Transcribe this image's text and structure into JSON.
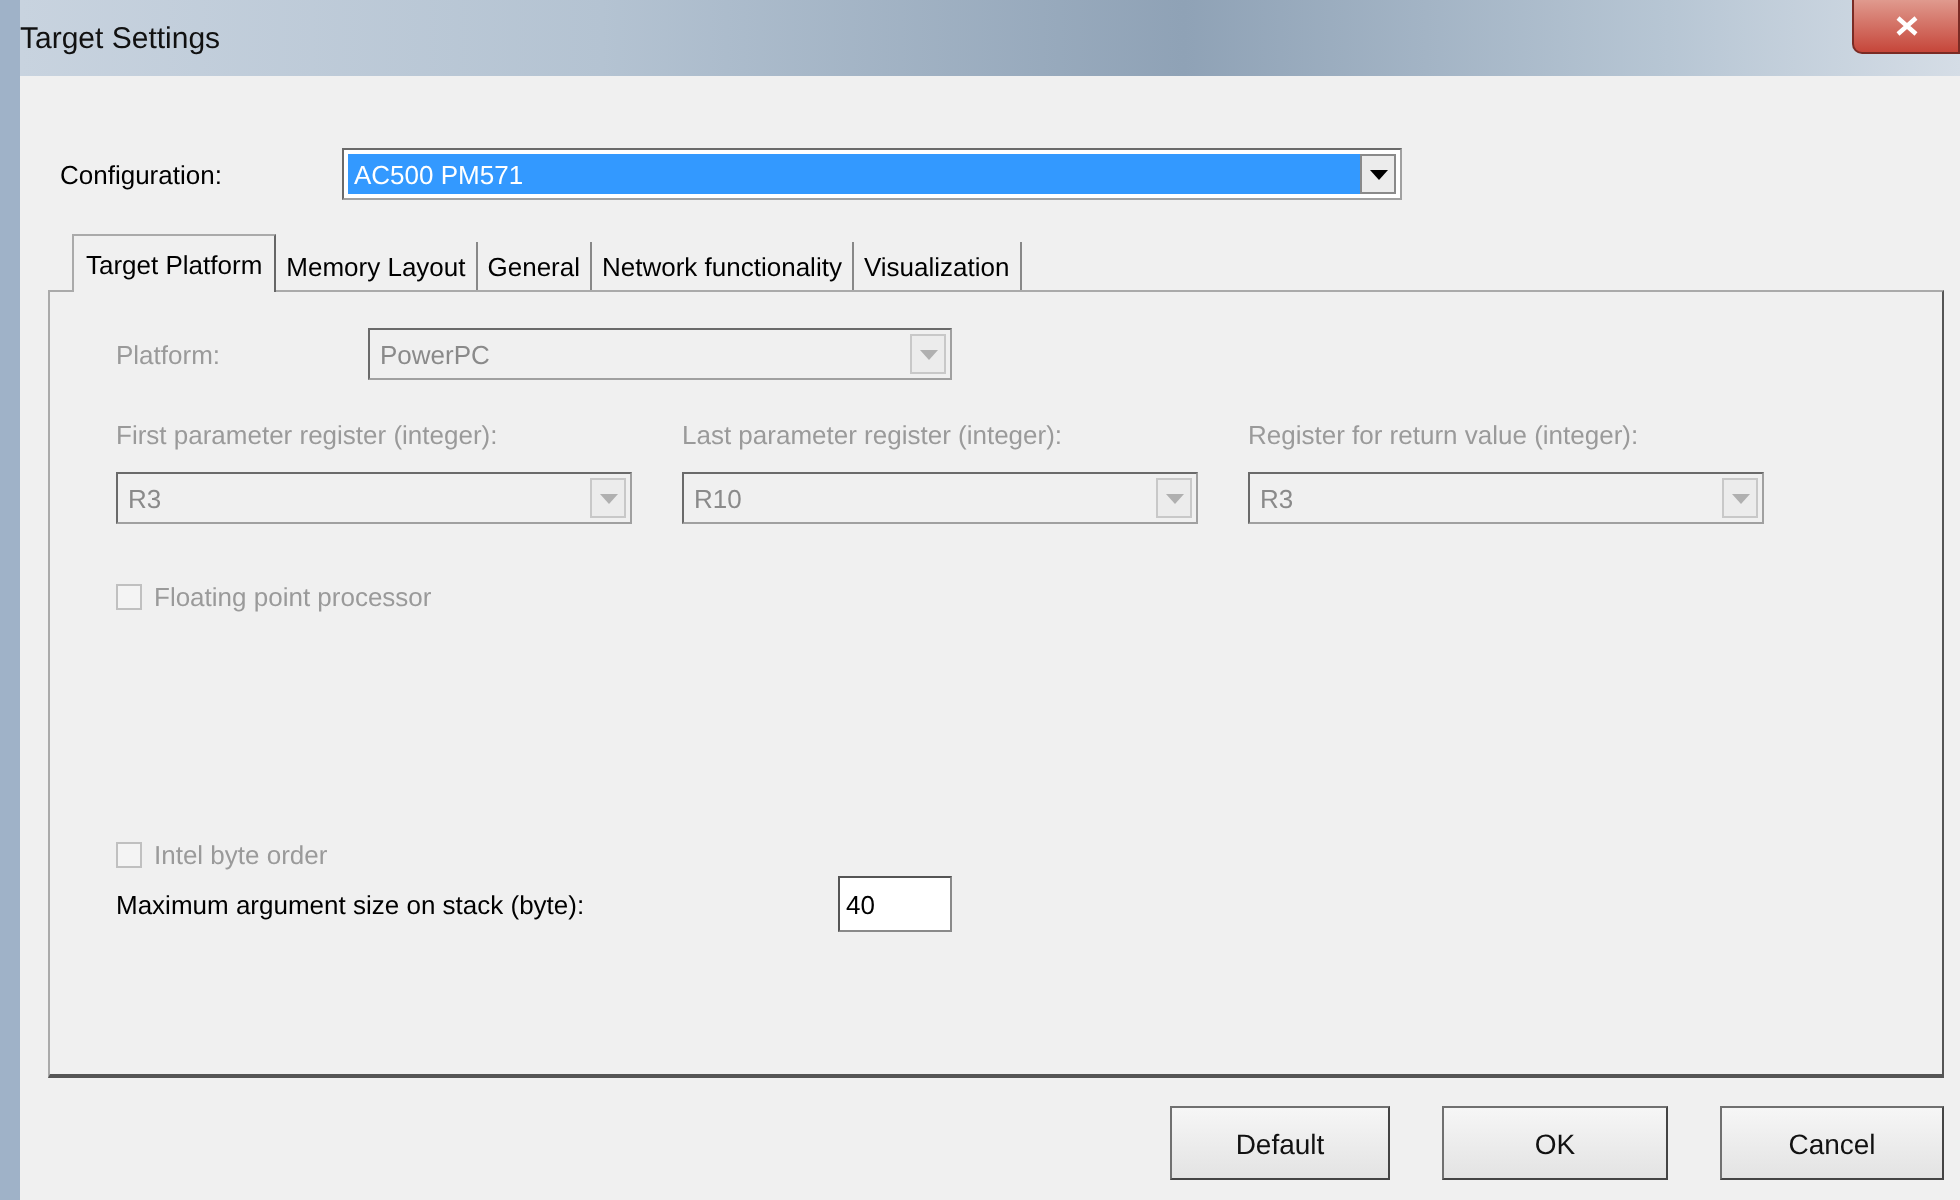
{
  "window": {
    "title": "Target Settings"
  },
  "configuration": {
    "label": "Configuration:",
    "value": "AC500 PM571",
    "selected": true
  },
  "tabs": [
    {
      "label": "Target Platform",
      "selected": true
    },
    {
      "label": "Memory Layout",
      "selected": false
    },
    {
      "label": "General",
      "selected": false
    },
    {
      "label": "Network functionality",
      "selected": false
    },
    {
      "label": "Visualization",
      "selected": false
    }
  ],
  "platform": {
    "label": "Platform:",
    "value": "PowerPC",
    "disabled": true
  },
  "registers": [
    {
      "label": "First parameter register (integer):",
      "value": "R3",
      "disabled": true
    },
    {
      "label": "Last parameter register (integer):",
      "value": "R10",
      "disabled": true
    },
    {
      "label": "Register for return value (integer):",
      "value": "R3",
      "disabled": true
    }
  ],
  "floating_point": {
    "label": "Floating point processor",
    "checked": false,
    "disabled": true
  },
  "intel_byte_order": {
    "label": "Intel byte order",
    "checked": false,
    "disabled": true
  },
  "max_argument_size": {
    "label": "Maximum argument size on stack (byte):",
    "value": "40"
  },
  "buttons": [
    {
      "label": "Default"
    },
    {
      "label": "OK"
    },
    {
      "label": "Cancel"
    }
  ]
}
